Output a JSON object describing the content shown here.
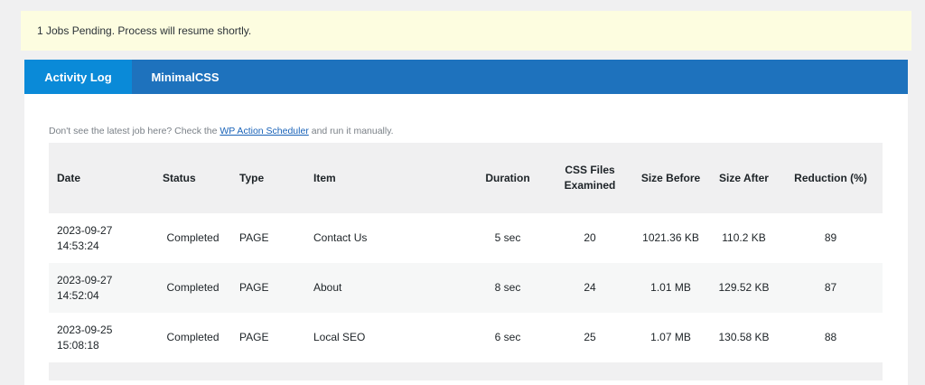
{
  "notice": {
    "text": "1 Jobs Pending. Process will resume shortly."
  },
  "tabs": [
    {
      "label": "Activity Log"
    },
    {
      "label": "MinimalCSS"
    }
  ],
  "hint": {
    "before": "Don't see the latest job here? Check the ",
    "link": "WP Action Scheduler",
    "after": " and run it manually."
  },
  "table": {
    "headers": {
      "date": "Date",
      "status": "Status",
      "type": "Type",
      "item": "Item",
      "duration": "Duration",
      "css_files": "CSS Files Examined",
      "size_before": "Size Before",
      "size_after": "Size After",
      "reduction": "Reduction (%)"
    },
    "rows": [
      {
        "date": "2023-09-27 14:53:24",
        "status": "Completed",
        "type": "PAGE",
        "item": "Contact Us",
        "duration": "5 sec",
        "css_files": "20",
        "size_before": "1021.36 KB",
        "size_after": "110.2 KB",
        "reduction": "89"
      },
      {
        "date": "2023-09-27 14:52:04",
        "status": "Completed",
        "type": "PAGE",
        "item": "About",
        "duration": "8 sec",
        "css_files": "24",
        "size_before": "1.01 MB",
        "size_after": "129.52 KB",
        "reduction": "87"
      },
      {
        "date": "2023-09-25 15:08:18",
        "status": "Completed",
        "type": "PAGE",
        "item": "Local SEO",
        "duration": "6 sec",
        "css_files": "25",
        "size_before": "1.07 MB",
        "size_after": "130.58 KB",
        "reduction": "88"
      }
    ]
  }
}
